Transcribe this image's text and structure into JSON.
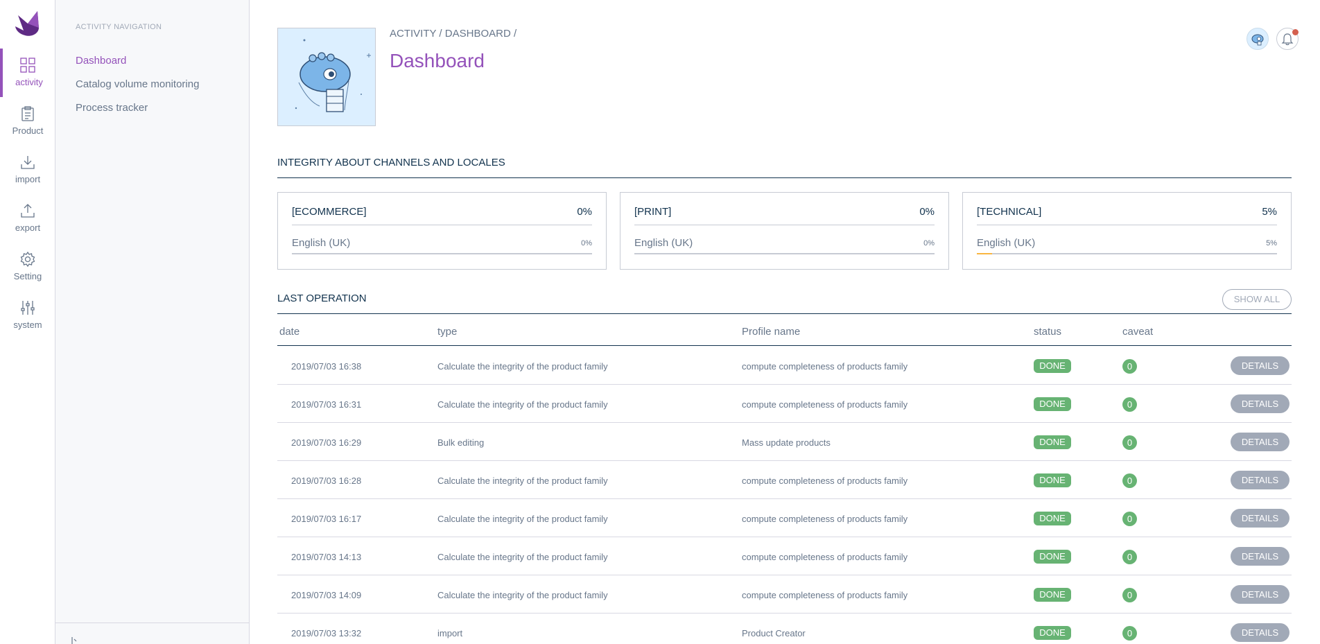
{
  "main_menu": {
    "items": [
      {
        "label": "activity",
        "icon": "dashboard-grid-icon",
        "active": true
      },
      {
        "label": "Product",
        "icon": "clipboard-icon",
        "active": false
      },
      {
        "label": "import",
        "icon": "import-icon",
        "active": false
      },
      {
        "label": "export",
        "icon": "export-icon",
        "active": false
      },
      {
        "label": "Setting",
        "icon": "gear-icon",
        "active": false
      },
      {
        "label": "system",
        "icon": "sliders-icon",
        "active": false
      }
    ]
  },
  "sub_nav": {
    "title": "ACTIVITY NAVIGATION",
    "items": [
      {
        "label": "Dashboard",
        "active": true
      },
      {
        "label": "Catalog volume monitoring",
        "active": false
      },
      {
        "label": "Process tracker",
        "active": false
      }
    ]
  },
  "header": {
    "breadcrumb": [
      "ACTIVITY",
      "DASHBOARD"
    ],
    "breadcrumb_sep": "/",
    "title": "Dashboard"
  },
  "integrity": {
    "title": "INTEGRITY ABOUT CHANNELS AND LOCALES",
    "cards": [
      {
        "name": "[ECOMMERCE]",
        "percent": "0%",
        "locale": "English (UK)",
        "locale_percent": "0%",
        "locale_fraction": 0
      },
      {
        "name": "[PRINT]",
        "percent": "0%",
        "locale": "English (UK)",
        "locale_percent": "0%",
        "locale_fraction": 0
      },
      {
        "name": "[TECHNICAL]",
        "percent": "5%",
        "locale": "English (UK)",
        "locale_percent": "5%",
        "locale_fraction": 0.05
      }
    ]
  },
  "last_operation": {
    "title": "LAST OPERATION",
    "show_all": "SHOW ALL",
    "columns": [
      "date",
      "type",
      "Profile name",
      "status",
      "caveat"
    ],
    "details_label": "DETAILS",
    "rows": [
      {
        "date": "2019/07/03 16:38",
        "type": "Calculate the integrity of the product family",
        "profile": "compute completeness of products family",
        "status": "DONE",
        "caveat": "0"
      },
      {
        "date": "2019/07/03 16:31",
        "type": "Calculate the integrity of the product family",
        "profile": "compute completeness of products family",
        "status": "DONE",
        "caveat": "0"
      },
      {
        "date": "2019/07/03 16:29",
        "type": "Bulk editing",
        "profile": "Mass update products",
        "status": "DONE",
        "caveat": "0"
      },
      {
        "date": "2019/07/03 16:28",
        "type": "Calculate the integrity of the product family",
        "profile": "compute completeness of products family",
        "status": "DONE",
        "caveat": "0"
      },
      {
        "date": "2019/07/03 16:17",
        "type": "Calculate the integrity of the product family",
        "profile": "compute completeness of products family",
        "status": "DONE",
        "caveat": "0"
      },
      {
        "date": "2019/07/03 14:13",
        "type": "Calculate the integrity of the product family",
        "profile": "compute completeness of products family",
        "status": "DONE",
        "caveat": "0"
      },
      {
        "date": "2019/07/03 14:09",
        "type": "Calculate the integrity of the product family",
        "profile": "compute completeness of products family",
        "status": "DONE",
        "caveat": "0"
      },
      {
        "date": "2019/07/03 13:32",
        "type": "import",
        "profile": "Product Creator",
        "status": "DONE",
        "caveat": "0"
      }
    ]
  },
  "colors": {
    "accent": "#9452ba",
    "success": "#67b373",
    "warning": "#f9b53f",
    "notification": "#d4604f"
  }
}
